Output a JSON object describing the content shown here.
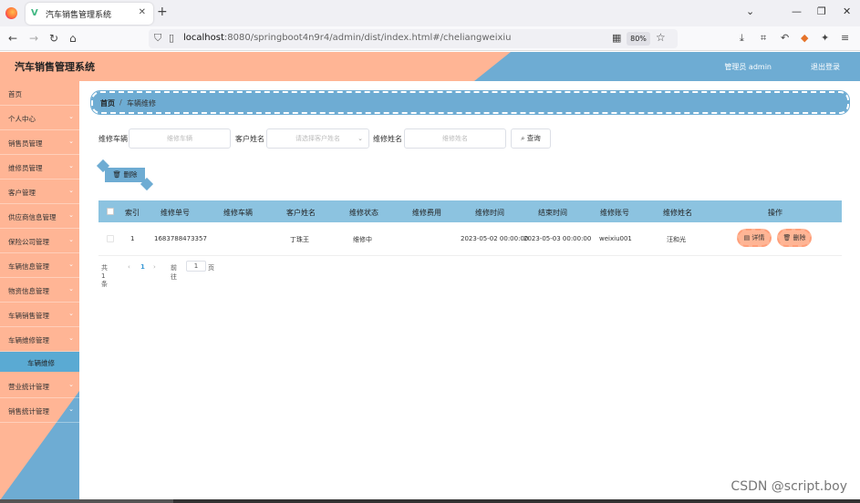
{
  "browser": {
    "tab_title": "汽车销售管理系统",
    "tab_icon": "V",
    "url_host": "localhost",
    "url_rest": ":8080/springboot4n9r4/admin/dist/index.html#/cheliangweixiu",
    "zoom": "80%"
  },
  "header": {
    "title": "汽车销售管理系统",
    "user": "管理员 admin",
    "logout": "退出登录"
  },
  "sidebar": {
    "items": [
      {
        "label": "首页",
        "has_chevron": false
      },
      {
        "label": "个人中心",
        "has_chevron": true
      },
      {
        "label": "销售员管理",
        "has_chevron": true
      },
      {
        "label": "维修员管理",
        "has_chevron": true
      },
      {
        "label": "客户管理",
        "has_chevron": true
      },
      {
        "label": "供应商信息管理",
        "has_chevron": true
      },
      {
        "label": "保险公司管理",
        "has_chevron": true
      },
      {
        "label": "车辆信息管理",
        "has_chevron": true
      },
      {
        "label": "物资信息管理",
        "has_chevron": true
      },
      {
        "label": "车辆销售管理",
        "has_chevron": true
      },
      {
        "label": "车辆维修管理",
        "has_chevron": true
      }
    ],
    "active_sub": "车辆维修",
    "items_after": [
      {
        "label": "营业统计管理",
        "has_chevron": true
      },
      {
        "label": "销售统计管理",
        "has_chevron": true
      }
    ]
  },
  "breadcrumb": {
    "home": "首页",
    "separator": "/",
    "current": "车辆维修"
  },
  "search": {
    "label_car": "维修车辆",
    "placeholder_car": "维修车辆",
    "label_customer": "客户姓名",
    "placeholder_customer": "请选择客户姓名",
    "label_repairer": "维修姓名",
    "placeholder_repairer": "维修姓名",
    "query_label": "查询"
  },
  "actions": {
    "delete_label": "删除"
  },
  "table": {
    "columns": [
      "索引",
      "维修单号",
      "维修车辆",
      "客户姓名",
      "维修状态",
      "维修费用",
      "维修时间",
      "结束时间",
      "维修账号",
      "维修姓名",
      "操作"
    ],
    "rows": [
      {
        "index": "1",
        "order_no": "1683788473357",
        "car": "",
        "customer": "丁珠王",
        "status": "维修中",
        "cost": "",
        "start_time": "2023-05-02 00:00:00",
        "end_time": "2023-05-03 00:00:00",
        "account": "weixiu001",
        "repairer": "汪和光",
        "detail_label": "详情",
        "delete_label": "删除"
      }
    ]
  },
  "pager": {
    "total": "共 1 条",
    "prev": "‹",
    "page": "1",
    "next": "›",
    "goto": "前往",
    "goto_value": "1",
    "page_unit": "页"
  },
  "watermark": "CSDN @script.boy",
  "colors": {
    "salmon": "#ffb595",
    "blue": "#6eacd3",
    "table_header": "#8cc3e0"
  }
}
